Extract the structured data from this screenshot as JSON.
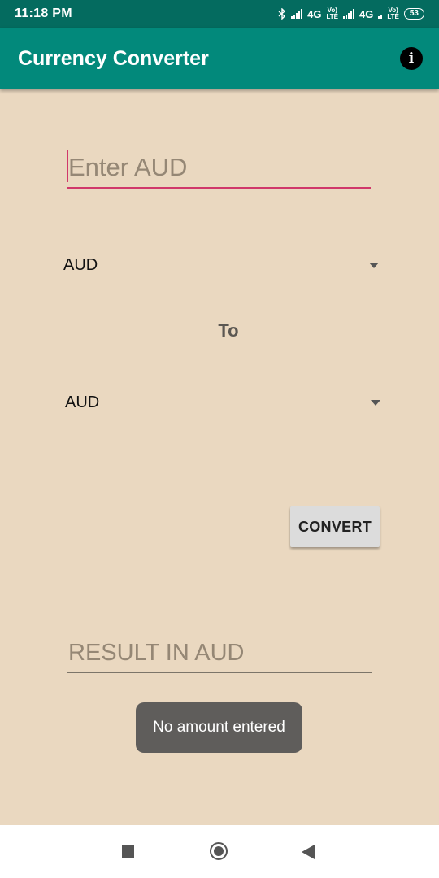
{
  "status_bar": {
    "time": "11:18 PM",
    "network1": "4G",
    "network2": "4G",
    "volte_top": "Vo)",
    "volte_bottom": "LTE",
    "battery": "53"
  },
  "app_bar": {
    "title": "Currency Converter",
    "info_icon": "info-icon",
    "info_glyph": "i"
  },
  "form": {
    "amount_placeholder": "Enter AUD",
    "from_currency": "AUD",
    "to_label": "To",
    "to_currency": "AUD",
    "convert_label": "CONVERT",
    "result_placeholder": "RESULT IN AUD"
  },
  "toast": {
    "message": "No amount entered"
  },
  "colors": {
    "status_bar": "#046b5f",
    "app_bar": "#02897b",
    "background": "#ead8c0",
    "accent": "#d0386a"
  }
}
